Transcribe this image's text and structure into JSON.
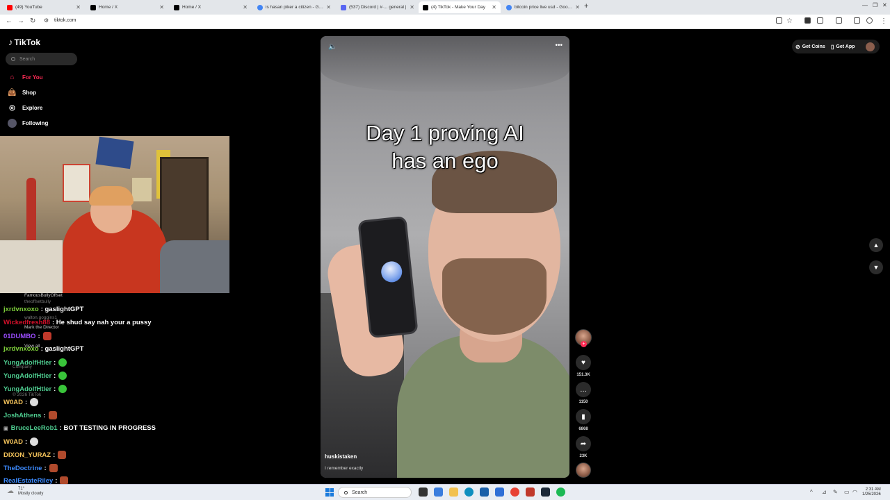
{
  "browser": {
    "tabs": [
      {
        "label": "(49) YouTube",
        "color": "#ff0000"
      },
      {
        "label": "Home / X",
        "color": "#000000"
      },
      {
        "label": "Home / X",
        "color": "#000000"
      },
      {
        "label": "is hasan piker a citizen - Googl",
        "color": "#4285f4"
      },
      {
        "label": "(537) Discord | #·... general |",
        "color": "#5865f2"
      },
      {
        "label": "(4) TikTok - Make Your Day",
        "color": "#000000"
      },
      {
        "label": "bitcoin price live usd - Google",
        "color": "#4285f4"
      }
    ],
    "active_tab_index": 5,
    "url": "tiktok.com"
  },
  "tiktok": {
    "logo": "TikTok",
    "search_placeholder": "Search",
    "nav": [
      {
        "label": "For You",
        "icon": "home-icon",
        "active": true
      },
      {
        "label": "Shop",
        "icon": "bag-icon",
        "active": false
      },
      {
        "label": "Explore",
        "icon": "compass-icon",
        "active": false
      },
      {
        "label": "Following",
        "icon": "following-avatar-icon",
        "active": false
      }
    ],
    "header": {
      "get_coins": "Get Coins",
      "get_app": "Get App"
    },
    "video": {
      "caption_line1": "Day 1 proving AI",
      "caption_line2": "has an ego",
      "author": "huskistaken",
      "description": "I remember exactly"
    },
    "actions": {
      "likes": "151.3K",
      "comments": "1150",
      "saves": "6868",
      "shares": "23K"
    }
  },
  "chat": {
    "messages": [
      {
        "user": "jxrdvnxoxo",
        "color": "#7fd13b",
        "text": "gaslightGPT",
        "emote": ""
      },
      {
        "user": "Wickedfresh88",
        "color": "#d3102a",
        "text": "He shud say nah your a pussy",
        "emote": ""
      },
      {
        "user": "01DUMBO",
        "color": "#9b4dff",
        "text": "",
        "emote": "#c0392b"
      },
      {
        "user": "jxrdvnxoxo",
        "color": "#7fd13b",
        "text": "gaslightGPT",
        "emote": ""
      },
      {
        "user": "YungAdolfHtler",
        "color": "#4ecb8f",
        "text": "",
        "emote": "#39c43a"
      },
      {
        "user": "YungAdolfHtler",
        "color": "#4ecb8f",
        "text": "",
        "emote": "#39c43a"
      },
      {
        "user": "YungAdolfHtler",
        "color": "#4ecb8f",
        "text": "",
        "emote": "#39c43a"
      },
      {
        "user": "W0AD",
        "color": "#f3c25a",
        "text": "",
        "emote": "#dddddd"
      },
      {
        "user": "JoshAthens",
        "color": "#4ecb8f",
        "text": "",
        "emote": "#b04a2c"
      },
      {
        "user": "BruceLeeRob1",
        "color": "#4ecb8f",
        "text": "BOT TESTING IN PROGRESS",
        "emote": ""
      },
      {
        "user": "W0AD",
        "color": "#f3c25a",
        "text": "",
        "emote": "#dddddd"
      },
      {
        "user": "DIXON_YURAZ",
        "color": "#f3c25a",
        "text": "",
        "emote": "#b04a2c"
      },
      {
        "user": "TheDoctrine",
        "color": "#3d8bff",
        "text": "",
        "emote": "#b04a2c"
      },
      {
        "user": "RealEstateRiley",
        "color": "#3d8bff",
        "text": "",
        "emote": "#b04a2c"
      }
    ],
    "ghost_texts": {
      "following_1": "FamousBullyOffset",
      "following_1_sub": "theoffsetbully",
      "following_2_sub": "walton.goggins1",
      "following_3": "Mark the Director",
      "view_all": "View all",
      "company": "Company",
      "copyright": "© 2026 TikTok"
    }
  },
  "taskbar": {
    "weather_temp": "71°",
    "weather_desc": "Mostly cloudy",
    "search_label": "Search",
    "time": "2:31 AM",
    "date": "1/25/2026"
  }
}
